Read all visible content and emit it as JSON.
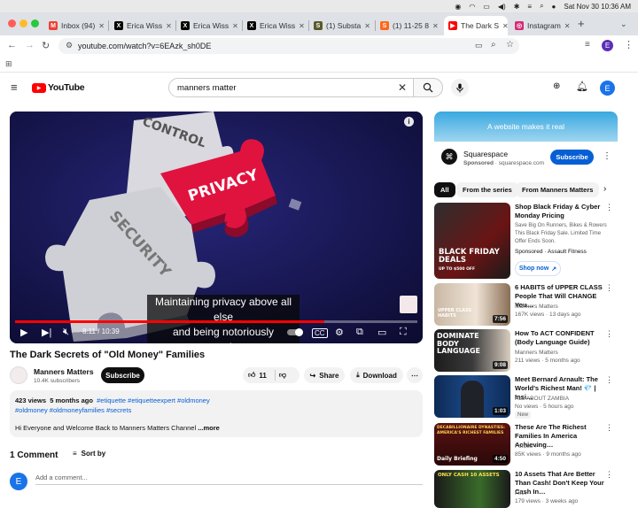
{
  "menubar": {
    "datetime": "Sat Nov 30  10:36 AM"
  },
  "tabs": [
    {
      "label": "Inbox (94)",
      "icon": "gmail-icon",
      "color": "#ea4335",
      "glyph": "M"
    },
    {
      "label": "Erica Wiss",
      "icon": "x-icon",
      "color": "#000000",
      "glyph": "X"
    },
    {
      "label": "Erica Wiss",
      "icon": "x-icon",
      "color": "#000000",
      "glyph": "X"
    },
    {
      "label": "Erica Wiss",
      "icon": "x-icon",
      "color": "#000000",
      "glyph": "X"
    },
    {
      "label": "(1) Substa",
      "icon": "substack-icon",
      "color": "#5a5a2a",
      "glyph": "S"
    },
    {
      "label": "(1) 11-25 8",
      "icon": "substack-icon",
      "color": "#ff6719",
      "glyph": "S"
    },
    {
      "label": "The Dark S",
      "icon": "youtube-icon",
      "color": "#ff0000",
      "glyph": "▶"
    },
    {
      "label": "Instagram",
      "icon": "instagram-icon",
      "color": "#d62976",
      "glyph": "◎"
    }
  ],
  "address": {
    "url": "youtube.com/watch?v=6EAzk_sh0DE"
  },
  "profile": {
    "initial": "E"
  },
  "youtube": {
    "logo_text": "YouTube",
    "search_value": "manners matter",
    "avatar_initial": "E"
  },
  "player": {
    "caption_line1": "Maintaining privacy above all else",
    "caption_line2": "and being notoriously secretive.",
    "time": "8:11 / 10:39",
    "progress": 0.769,
    "puzzle_words": [
      "CONTROL",
      "PRIVACY",
      "SECURITY"
    ]
  },
  "video": {
    "title": "The Dark Secrets of \"Old Money\" Families",
    "channel": "Manners Matters",
    "subscribers": "10.4K subscribers",
    "subscribe_label": "Subscribe",
    "likes": "11",
    "share_label": "Share",
    "download_label": "Download",
    "views": "423 views",
    "age": "5 months ago",
    "hashtags_line1": "#etiquette #etiquetteexpert #oldmoney",
    "hashtags_line2": "#oldmoney #oldmoneyfamilies #secrets",
    "description": "Hi Everyone and Welcome Back to Manners Matters Channel",
    "more_label": "...more"
  },
  "comments": {
    "count_label": "1 Comment",
    "sort_label": "Sort by",
    "placeholder": "Add a comment...",
    "avatar_initial": "E"
  },
  "ad": {
    "banner_text": "A website makes it real",
    "brand": "Squarespace",
    "sponsored": "Sponsored",
    "domain": "squarespace.com",
    "subscribe_label": "Subscribe"
  },
  "chips": [
    "All",
    "From the series",
    "From Manners Matters"
  ],
  "recommendations": [
    {
      "title": "Shop Black Friday & Cyber Monday Pricing",
      "meta1": "Save Big On Runners, Bikes & Rowers This Black Friday Sale. Limited Time Offer Ends Soon.",
      "meta2": "Sponsored · Assault Fitness",
      "cta": "Shop now",
      "thumb_text": "BLACK FRIDAY DEALS",
      "thumb_sub": "UP TO $500 OFF",
      "duration": ""
    },
    {
      "title": "6 HABITS of UPPER CLASS People That Will CHANGE You…",
      "meta1": "Manners Matters",
      "meta2": "167K views · 13 days ago",
      "thumb_text": "UPPER CLASS HABITS",
      "duration": "7:56"
    },
    {
      "title": "How To ACT CONFIDENT (Body Language Guide)",
      "meta1": "Manners Matters",
      "meta2": "211 views · 5 months ago",
      "thumb_text": "DOMINATE BODY LANGUAGE",
      "duration": "9:08"
    },
    {
      "title": "Meet Bernard Arnault: The World's Richest Man! 💎 | Insi…",
      "meta1": "ALL ABOUT ZAMBIA",
      "meta2": "No views · 5 hours ago",
      "badge": "New",
      "duration": "1:03"
    },
    {
      "title": "These Are The Richest Families In America Achieving…",
      "meta1": "Forbes ✓",
      "meta2": "85K views · 9 months ago",
      "thumb_text": "DECABILLIONAIRE DYNASTIES: AMERICA'S RICHEST FAMILIES",
      "thumb_sub": "Daily Briefing",
      "duration": "4:50"
    },
    {
      "title": "10 Assets That Are Better Than Cash! Don't Keep Your Cash In…",
      "meta1": "FinX",
      "meta2": "179 views · 3 weeks ago",
      "thumb_text": "ONLY CASH  10 ASSETS",
      "duration": ""
    }
  ]
}
